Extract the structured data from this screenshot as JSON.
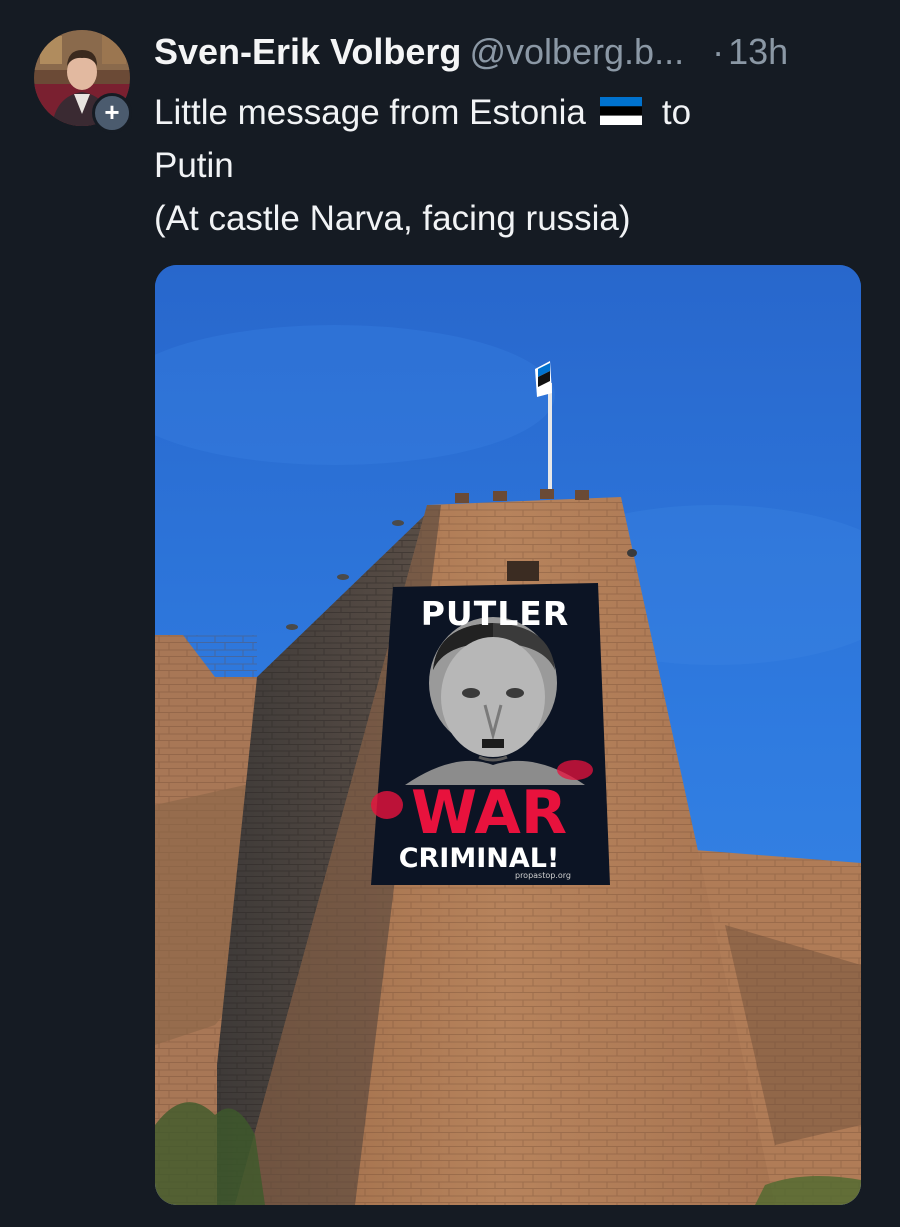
{
  "post": {
    "author": {
      "display_name": "Sven-Erik Volberg",
      "handle": "@volberg.b...",
      "avatar_icon": "avatar-photo",
      "follow_badge": "+"
    },
    "separator": "·",
    "timestamp": "13h",
    "text": {
      "line1_before_flag": "Little message from Estonia",
      "flag_icon": "estonia-flag-icon",
      "line1_after_flag": "to",
      "line2": "Putin",
      "line3": "(At castle Narva, facing russia)"
    },
    "media": {
      "banner": {
        "title": "PUTLER",
        "headline": "WAR",
        "subline": "CRIMINAL!",
        "url": "propastop.org"
      }
    }
  },
  "colors": {
    "background": "#151b23",
    "text_primary": "#f1f3f5",
    "text_secondary": "#8b98a5",
    "sky": "#2a6fd1",
    "war_red": "#e8123d"
  }
}
